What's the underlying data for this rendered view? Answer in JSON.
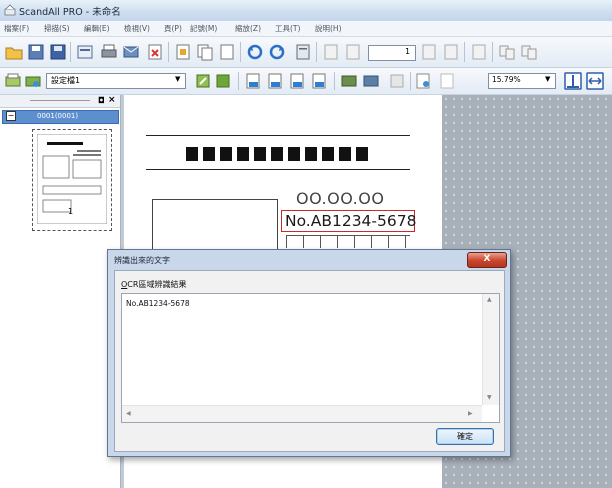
{
  "window": {
    "title": "ScandAll PRO - 未命名"
  },
  "menu": {
    "items": [
      "檔案(F)",
      "掃描(S)",
      "編輯(E)",
      "檢視(V)",
      "頁(P)",
      "記號(M)",
      "縮放(Z)",
      "工具(T)",
      "說明(H)"
    ]
  },
  "toolbar1": {
    "page_input_value": "1"
  },
  "toolbar2": {
    "profile_select_value": "設定檔1",
    "zoom_select_value": "15.79%"
  },
  "thumbnails": {
    "tree_label": "0001(0001)",
    "page_number": "1"
  },
  "document": {
    "code_text": "OO.OO.OO",
    "highlight_text": "No.AB1234-5678"
  },
  "dialog": {
    "title": "辨識出來的文字",
    "close_label": "X",
    "section_label_mnemonic": "O",
    "section_label_rest": "CR區域辨識結果",
    "result_text": "No.AB1234-5678",
    "ok_label": "確定"
  },
  "colors": {
    "highlight_border": "#cc2a2a",
    "close_button": "#c8452c",
    "tree_selection": "#5d8fcf"
  }
}
